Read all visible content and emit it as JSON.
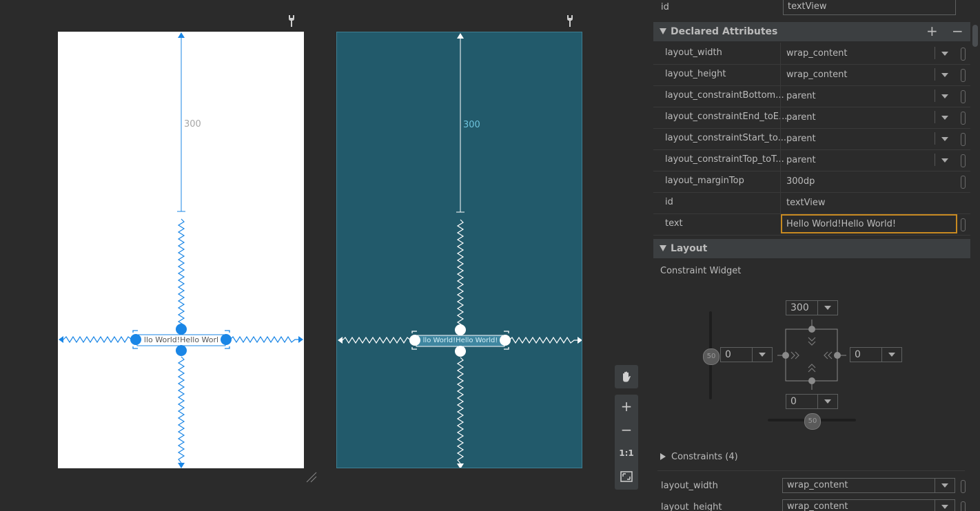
{
  "design": {
    "margin_top_label": "300",
    "textview_text": "Hello World!Hello World!",
    "textview_clipped_left": "llo World!Hello Worl",
    "textview_clipped_right": "llo World!Hello World!"
  },
  "toolbox": {
    "pan_icon": "hand-icon",
    "zoom_in": "+",
    "zoom_out": "−",
    "actual_size": "1:1",
    "fit_icon": "fit-screen-icon"
  },
  "attributes": {
    "id_top": {
      "key": "id",
      "value": "textView"
    },
    "declared_title": "Declared Attributes",
    "add_label": "+",
    "remove_label": "−",
    "rows": [
      {
        "key": "layout_width",
        "value": "wrap_content"
      },
      {
        "key": "layout_height",
        "value": "wrap_content"
      },
      {
        "key": "layout_constraintBottom...",
        "value": "parent"
      },
      {
        "key": "layout_constraintEnd_toE...",
        "value": "parent"
      },
      {
        "key": "layout_constraintStart_to...",
        "value": "parent"
      },
      {
        "key": "layout_constraintTop_toT...",
        "value": "parent"
      },
      {
        "key": "layout_marginTop",
        "value": "300dp"
      },
      {
        "key": "id",
        "value": "textView"
      },
      {
        "key": "text",
        "value": "Hello World!Hello World!"
      }
    ]
  },
  "layout": {
    "title": "Layout",
    "subtitle": "Constraint Widget",
    "top_margin": "300",
    "bottom_margin": "0",
    "left_margin": "0",
    "right_margin": "0",
    "vertical_bias": "50",
    "horizontal_bias": "50",
    "constraints_label": "Constraints (4)",
    "bottom_rows": [
      {
        "key": "layout_width",
        "value": "wrap_content"
      },
      {
        "key": "layout_height",
        "value": "wrap_content"
      }
    ]
  },
  "colors": {
    "blueprint": "#225a6b",
    "accent_blue": "#1a86e6",
    "focus_orange": "#c88a21"
  }
}
